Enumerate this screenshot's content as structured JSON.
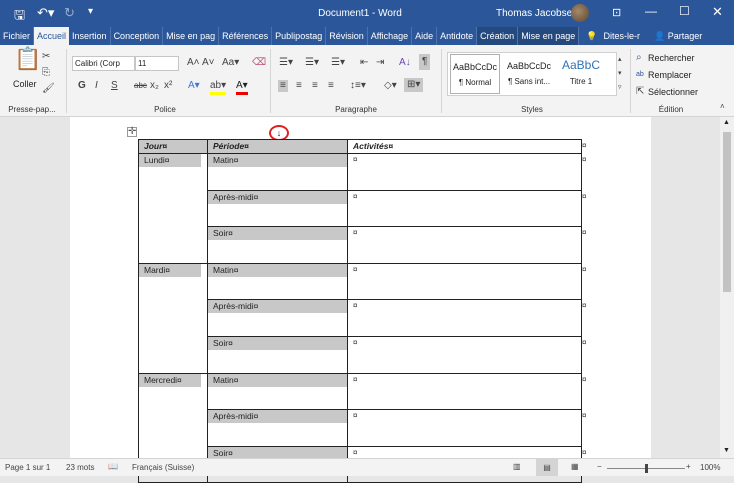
{
  "window": {
    "title": "Document1  -  Word",
    "user": "Thomas Jacobsen"
  },
  "tabs": [
    "Fichier",
    "Accueil",
    "Insertion",
    "Conception",
    "Mise en pag",
    "Références",
    "Publipostag",
    "Révision",
    "Affichage",
    "Aide",
    "Antidote",
    "Création",
    "Mise en page"
  ],
  "active_tab": "Accueil",
  "tell_me": "Dites-le-r",
  "share": "Partager",
  "ribbon": {
    "clipboard": {
      "paste": "Coller",
      "label": "Presse-pap..."
    },
    "font": {
      "name": "Calibri (Corp",
      "size": "11",
      "label": "Police",
      "bold": "G",
      "italic": "I",
      "underline": "S"
    },
    "paragraph": {
      "label": "Paragraphe"
    },
    "styles": {
      "label": "Styles",
      "items": [
        {
          "preview": "AaBbCcDc",
          "name": "¶ Normal"
        },
        {
          "preview": "AaBbCcDc",
          "name": "¶ Sans int..."
        },
        {
          "preview": "AaBbC",
          "name": "Titre 1"
        }
      ]
    },
    "editing": {
      "label": "Édition",
      "find": "Rechercher",
      "replace": "Remplacer",
      "select": "Sélectionner"
    }
  },
  "table": {
    "headers": [
      "Jour¤",
      "Période¤",
      "Activités¤"
    ],
    "days": [
      {
        "day": "Lundi¤",
        "periods": [
          "Matin¤",
          "Après-midi¤",
          "Soir¤"
        ]
      },
      {
        "day": "Mardi¤",
        "periods": [
          "Matin¤",
          "Après-midi¤",
          "Soir¤"
        ]
      },
      {
        "day": "Mercredi¤",
        "periods": [
          "Matin¤",
          "Après-midi¤",
          "Soir¤"
        ]
      }
    ],
    "cell_mark": "¤"
  },
  "status": {
    "page": "Page 1 sur 1",
    "words": "23 mots",
    "language": "Français (Suisse)",
    "zoom": "100%",
    "zoom_percent": 100
  },
  "colors": {
    "brand": "#2b579a",
    "shade": "#c8c8c8",
    "highlight_ring": "#e02020"
  }
}
